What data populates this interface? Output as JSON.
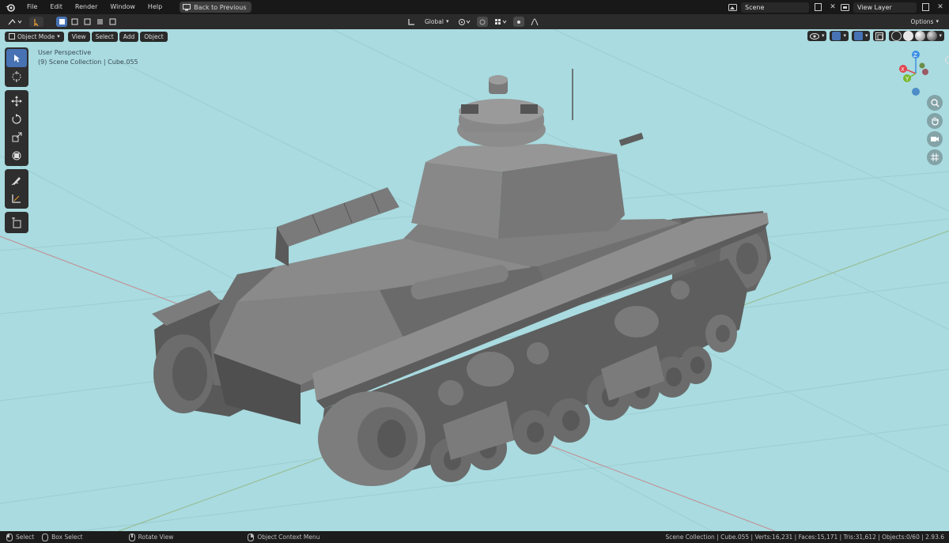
{
  "menu": {
    "items": [
      "File",
      "Edit",
      "Render",
      "Window",
      "Help"
    ],
    "back_label": "Back to Previous",
    "scene_label": "Scene",
    "view_layer_label": "View Layer"
  },
  "header": {
    "mode_label": "Object Mode",
    "view_label": "View",
    "select_label": "Select",
    "add_label": "Add",
    "object_label": "Object",
    "transform_orientation": "Global",
    "options_label": "Options"
  },
  "viewport": {
    "perspective_label": "User Perspective",
    "collection_label": "(9) Scene Collection | Cube.055",
    "background_color": "#a9dbe0",
    "gizmo": {
      "x": "X",
      "y": "Y",
      "z": "Z"
    }
  },
  "status": {
    "select_label": "Select",
    "box_select_label": "Box Select",
    "rotate_label": "Rotate View",
    "context_menu_label": "Object Context Menu",
    "stats": "Scene Collection | Cube.055 | Verts:16,231 | Faces:15,171 | Tris:31,612 | Objects:0/60 | 2.93.6"
  },
  "colors": {
    "accent": "#4772b3",
    "axis_x": "#e0454f",
    "axis_y": "#7cb82f",
    "axis_z": "#3e8fe3",
    "model_gray": "#7a7a7a"
  }
}
